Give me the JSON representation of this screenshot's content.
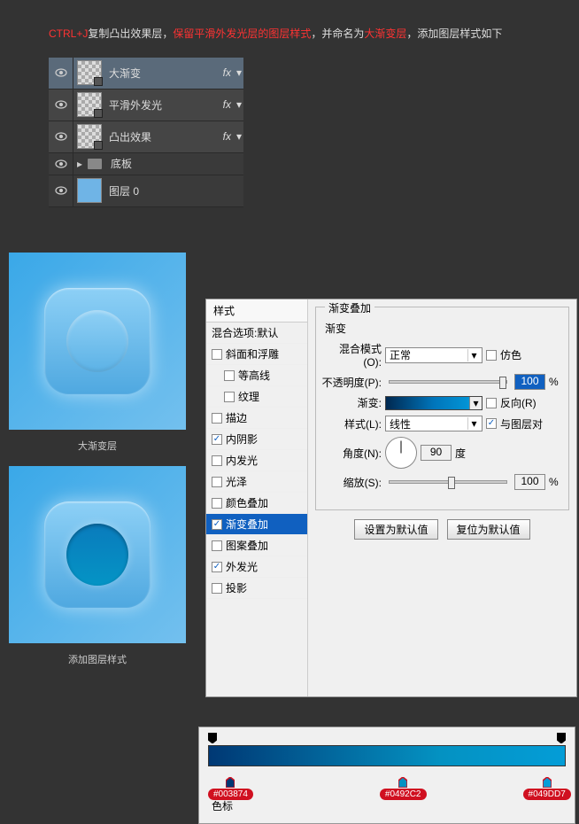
{
  "instruction": {
    "pre": "CTRL+J",
    "t1": "复制凸出效果层，",
    "t2": "保留平滑外发光层的图层样式",
    "t3": "，并命名为",
    "t4": "大渐变层",
    "t5": "，添加图层样式如下"
  },
  "layers": {
    "l1": "大渐变",
    "l2": "平滑外发光",
    "l3": "凸出效果",
    "l4": "底板",
    "l5": "图层 0",
    "fx": "fx"
  },
  "captions": {
    "c1": "大渐变层",
    "c2": "添加图层样式"
  },
  "styleList": {
    "header": "样式",
    "blend": "混合选项:默认",
    "bevel": "斜面和浮雕",
    "contour": "等高线",
    "texture": "纹理",
    "stroke": "描边",
    "innerShadow": "内阴影",
    "innerGlow": "内发光",
    "satin": "光泽",
    "colorOverlay": "颜色叠加",
    "gradOverlay": "渐变叠加",
    "patternOverlay": "图案叠加",
    "outerGlow": "外发光",
    "dropShadow": "投影"
  },
  "gradOverlay": {
    "groupTitle": "渐变叠加",
    "subTitle": "渐变",
    "blendMode": "混合模式(O):",
    "blendModeVal": "正常",
    "dither": "仿色",
    "opacity": "不透明度(P):",
    "opacityVal": "100",
    "gradient": "渐变:",
    "reverse": "反向(R)",
    "style": "样式(L):",
    "styleVal": "线性",
    "alignLayer": "与图层对",
    "angle": "角度(N):",
    "angleVal": "90",
    "deg": "度",
    "scale": "缩放(S):",
    "scaleVal": "100",
    "setDefault": "设置为默认值",
    "resetDefault": "复位为默认值",
    "pct": "%"
  },
  "gradEditor": {
    "stop1": "#003874",
    "stop2": "#0492C2",
    "stop3": "#049DD7",
    "sectionLabel": "色标"
  }
}
